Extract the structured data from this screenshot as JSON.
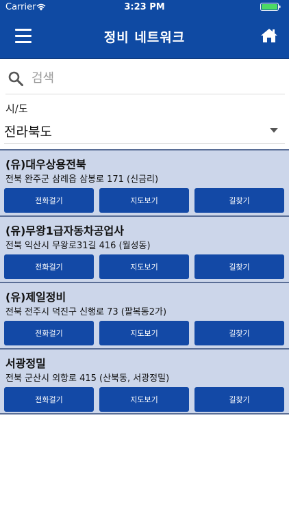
{
  "status": {
    "carrier": "Carrier",
    "time": "3:23 PM"
  },
  "nav": {
    "title": "정비 네트워크",
    "menu_icon": "menu-icon",
    "home_icon": "home-icon"
  },
  "search": {
    "placeholder": "검색",
    "value": ""
  },
  "region": {
    "label": "시/도",
    "selected": "전라북도"
  },
  "shops": [
    {
      "name": "(유)대우상용전북",
      "address": "전북 완주군 삼례읍 삼봉로 171 (신금리)",
      "call": "전화걸기",
      "map": "지도보기",
      "route": "길찾기"
    },
    {
      "name": "(유)무왕1급자동차공업사",
      "address": "전북 익산시 무왕로31길 416 (월성동)",
      "call": "전화걸기",
      "map": "지도보기",
      "route": "길찾기"
    },
    {
      "name": "(유)제일정비",
      "address": "전북 전주시 덕진구 신행로 73 (팔복동2가)",
      "call": "전화걸기",
      "map": "지도보기",
      "route": "길찾기"
    },
    {
      "name": "서광정밀",
      "address": "전북 군산시 외항로 415 (산북동, 서광정밀)",
      "call": "전화걸기",
      "map": "지도보기",
      "route": "길찾기"
    }
  ],
  "colors": {
    "header": "#0f4aa3",
    "button": "#1349a6",
    "card": "#ccd6ea",
    "battery": "#4cd964"
  }
}
